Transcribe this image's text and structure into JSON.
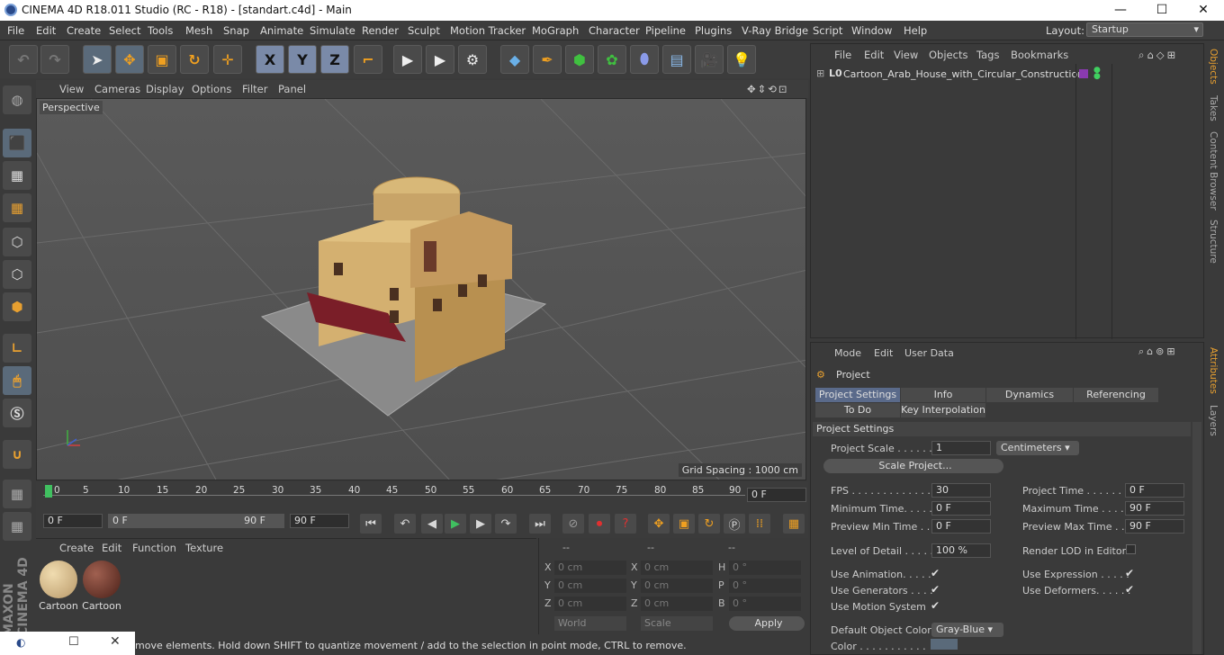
{
  "title": "CINEMA 4D R18.011 Studio (RC - R18) - [standart.c4d] - Main",
  "window_controls": {
    "min": "—",
    "max": "☐",
    "close": "✕"
  },
  "menu": [
    "File",
    "Edit",
    "Create",
    "Select",
    "Tools",
    "Mesh",
    "Snap",
    "Animate",
    "Simulate",
    "Render",
    "Sculpt",
    "Motion Tracker",
    "MoGraph",
    "Character",
    "Pipeline",
    "Plugins",
    "V-Ray Bridge",
    "Script",
    "Window",
    "Help"
  ],
  "layout": {
    "label": "Layout:",
    "value": "Startup"
  },
  "toolbar": {
    "x": "X",
    "y": "Y",
    "z": "Z"
  },
  "viewport": {
    "menu": [
      "View",
      "Cameras",
      "Display",
      "Options",
      "Filter",
      "Panel"
    ],
    "camera": "Perspective",
    "grid_spacing": "Grid Spacing : 1000 cm"
  },
  "timeline": {
    "ticks": [
      "0",
      "5",
      "10",
      "15",
      "20",
      "25",
      "30",
      "35",
      "40",
      "45",
      "50",
      "55",
      "60",
      "65",
      "70",
      "75",
      "80",
      "85",
      "90"
    ],
    "current": "0 F"
  },
  "transport": {
    "start": "0 F",
    "range_start": "0 F",
    "range_end": "90 F",
    "end": "90 F"
  },
  "materials": {
    "menu": [
      "Create",
      "Edit",
      "Function",
      "Texture"
    ],
    "items": [
      "Cartoon",
      "Cartoon"
    ]
  },
  "coords": {
    "header": [
      "--",
      "--",
      "--"
    ],
    "rows": [
      [
        "X",
        "0 cm",
        "X",
        "0 cm",
        "H",
        "0 °"
      ],
      [
        "Y",
        "0 cm",
        "Y",
        "0 cm",
        "P",
        "0 °"
      ],
      [
        "Z",
        "0 cm",
        "Z",
        "0 cm",
        "B",
        "0 °"
      ]
    ],
    "world": "World",
    "scale": "Scale",
    "apply": "Apply"
  },
  "status": "move elements. Hold down SHIFT to quantize movement / add to the selection in point mode, CTRL to remove.",
  "objects": {
    "menu": [
      "File",
      "Edit",
      "View",
      "Objects",
      "Tags",
      "Bookmarks"
    ],
    "items": [
      "Cartoon_Arab_House_with_Circular_Construction"
    ]
  },
  "attributes": {
    "menu": [
      "Mode",
      "Edit",
      "User Data"
    ],
    "heading": "Project",
    "tabs": [
      "Project Settings",
      "Info",
      "Dynamics",
      "Referencing",
      "To Do",
      "Key Interpolation"
    ],
    "section": "Project Settings",
    "project_scale_label": "Project Scale . . . . . .",
    "project_scale": "1",
    "unit": "Centimeters",
    "scale_project": "Scale Project...",
    "fps_label": "FPS . . . . . . . . . . . . . .",
    "fps": "30",
    "project_time_label": "Project Time . . . . . . . .",
    "project_time": "0 F",
    "min_time_label": "Minimum Time. . . . .",
    "min_time": "0 F",
    "max_time_label": "Maximum Time . . . . .",
    "max_time": "90 F",
    "prev_min_label": "Preview Min Time . .",
    "prev_min": "0 F",
    "prev_max_label": "Preview Max Time . . .",
    "prev_max": "90 F",
    "lod_label": "Level of Detail . . . . .",
    "lod": "100 %",
    "render_lod_label": "Render LOD in Editor",
    "use_anim": "Use Animation. . . . .",
    "use_expr": "Use Expression . . . . .",
    "use_gen": "Use Generators . . . .",
    "use_def": "Use Deformers. . . . . .",
    "use_motion": "Use Motion System",
    "obj_color_label": "Default Object Color",
    "obj_color": "Gray-Blue",
    "color_label": "Color . . . . . . . . . . ."
  },
  "side_tabs": [
    "Objects",
    "Takes",
    "Content Browser",
    "Structure",
    "Attributes",
    "Layers"
  ],
  "logo": "MAXON CINEMA 4D",
  "colors": {
    "accent": "#5a6a8a",
    "awning": "#7a1e28",
    "house": "#d4b070"
  }
}
